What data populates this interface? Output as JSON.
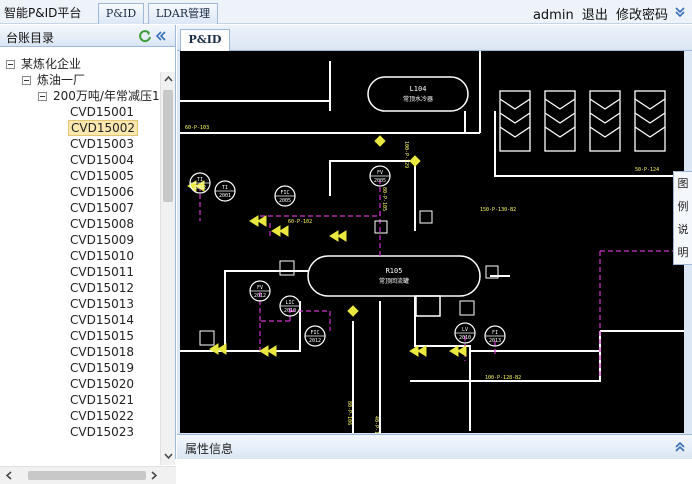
{
  "topbar": {
    "app_title": "智能P&ID平台",
    "tabs": [
      "P&ID",
      "LDAR管理"
    ],
    "user": "admin",
    "logout": "退出",
    "change_password": "修改密码"
  },
  "sidebar": {
    "title": "台账目录",
    "tree": {
      "company": "某炼化企业",
      "plant": "炼油一厂",
      "unit": "200万吨/年常减压1",
      "items": [
        "CVD15001",
        "CVD15002",
        "CVD15003",
        "CVD15004",
        "CVD15005",
        "CVD15006",
        "CVD15007",
        "CVD15008",
        "CVD15009",
        "CVD15010",
        "CVD15011",
        "CVD15012",
        "CVD15013",
        "CVD15014",
        "CVD15015",
        "CVD15018",
        "CVD15019",
        "CVD15020",
        "CVD15021",
        "CVD15022",
        "CVD15023"
      ],
      "selected": "CVD15002"
    }
  },
  "main": {
    "tab": "P&ID",
    "legend_chars": [
      "图",
      "例",
      "说",
      "明"
    ],
    "properties_label": "属性信息"
  },
  "diagram": {
    "vessel_top": "L104",
    "vessel_top_sub": "常顶水冷器",
    "vessel_main": "R105",
    "vessel_main_sub": "常顶回流罐",
    "instruments": [
      {
        "tag": "TI",
        "num": "2001"
      },
      {
        "tag": "FIC",
        "num": "2005"
      },
      {
        "tag": "FV",
        "num": "2005"
      },
      {
        "tag": "TI",
        "num": "2002"
      },
      {
        "tag": "LIC",
        "num": "2010"
      },
      {
        "tag": "FV",
        "num": "2012"
      },
      {
        "tag": "FIC",
        "num": "2012"
      },
      {
        "tag": "LV",
        "num": "2010"
      },
      {
        "tag": "FI",
        "num": "2013"
      }
    ],
    "line_labels": [
      "60-P-103",
      "100-P-129",
      "60-P-102",
      "80-P-105",
      "150-P-130-B2",
      "100-P-128-B2",
      "80-P-106",
      "40-P-121",
      "50-P-124"
    ],
    "colors": {
      "pipe": "#ffffff",
      "signal": "#cc33cc",
      "valve": "#e8e840",
      "equipment": "#ffffff",
      "label": "#ffff66"
    }
  }
}
